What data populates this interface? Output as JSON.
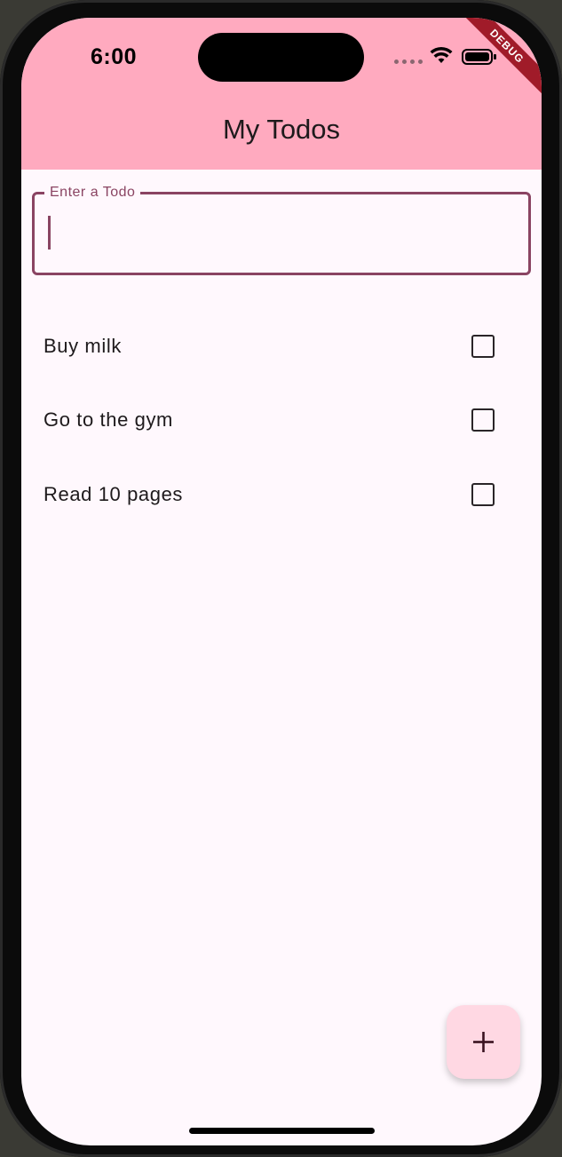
{
  "status_bar": {
    "time": "6:00",
    "icons": [
      "signal-dots-icon",
      "wifi-icon",
      "battery-icon"
    ]
  },
  "debug_banner": "DEBUG",
  "app_bar": {
    "title": "My Todos",
    "color": "#ffaabf"
  },
  "todo_input": {
    "label": "Enter a Todo",
    "value": "",
    "accent_color": "#8a4462"
  },
  "todos": [
    {
      "text": "Buy milk",
      "checked": false
    },
    {
      "text": "Go to the gym",
      "checked": false
    },
    {
      "text": "Read 10 pages",
      "checked": false
    }
  ],
  "fab": {
    "icon": "plus-icon",
    "color": "#ffd8e3"
  },
  "background_color": "#fff8fd"
}
